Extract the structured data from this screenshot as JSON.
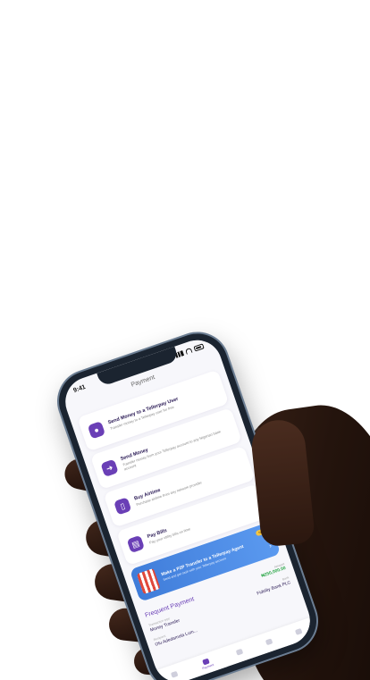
{
  "status": {
    "time": "9:41"
  },
  "page": {
    "title": "Payment"
  },
  "cards": [
    {
      "title": "Send Money to a Tellerpay User",
      "subtitle": "Transfer money to a Tellerpay user for free",
      "icon": "user-icon"
    },
    {
      "title": "Send Money",
      "subtitle": "Transfer money from your Tellerpay account to any Nigerian bank account",
      "icon": "transfer-icon"
    },
    {
      "title": "Buy Airtime",
      "subtitle": "Purchase airtime from any network provider",
      "icon": "phone-icon"
    },
    {
      "title": "Pay Bills",
      "subtitle": "Pay your utility bills on time",
      "icon": "bills-icon"
    }
  ],
  "banner": {
    "title": "Make a P2P Transfer to a Tellerpay Agent",
    "subtitle": "Send and get cash with your Tellerpay account",
    "badge": "New"
  },
  "frequent": {
    "title": "Frequent Payment",
    "amount_label": "Amount",
    "amount": "₦250,000.00",
    "items": [
      {
        "label": "Transaction type",
        "value": "Money Transfer"
      },
      {
        "label": "Bank",
        "value": "Fidelity Bank PLC"
      }
    ],
    "recipient_label": "Recipient",
    "recipient": "Olu Adedamola Lum..."
  },
  "tabs": [
    {
      "label": ""
    },
    {
      "label": "Payment"
    },
    {
      "label": ""
    },
    {
      "label": ""
    },
    {
      "label": ""
    }
  ],
  "colors": {
    "accent": "#6a3fb6",
    "banner": "#4a89e4",
    "success": "#2da84a"
  }
}
